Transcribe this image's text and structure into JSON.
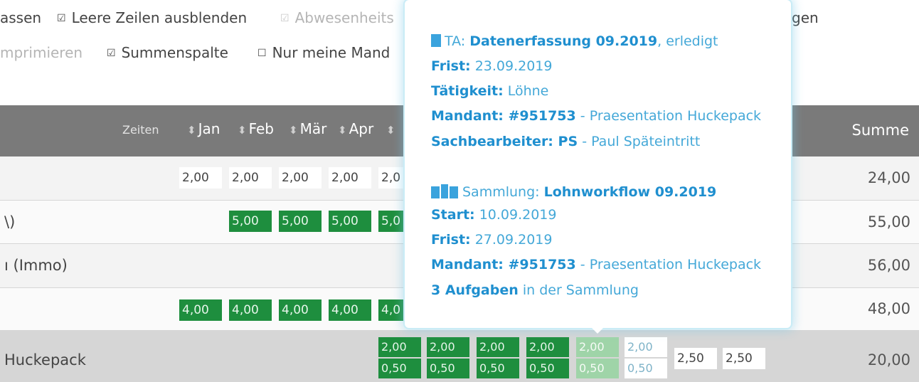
{
  "options": [
    {
      "label": "assen",
      "checked": null,
      "dim": false
    },
    {
      "label": "Leere Zeilen ausblenden",
      "checked": true,
      "dim": false
    },
    {
      "label": "Abwesenheits",
      "checked": true,
      "dim": true
    },
    {
      "label": "gen",
      "checked": null,
      "dim": false
    },
    {
      "label": "mprimieren",
      "checked": null,
      "dim": true
    },
    {
      "label": "Summenspalte",
      "checked": true,
      "dim": false
    },
    {
      "label": "Nur meine Mand",
      "checked": false,
      "dim": false
    }
  ],
  "checkbox_glyphs": {
    "checked": "☑",
    "unchecked": "☐"
  },
  "table": {
    "zeiten_label": "Zeiten",
    "months": [
      "Jan",
      "Feb",
      "Mär",
      "Apr"
    ],
    "sum_header": "Summe",
    "sort_glyph": "⬍"
  },
  "rows": [
    {
      "label": "",
      "sum": "24,00",
      "cells": [
        {
          "v": "2,00",
          "t": "w"
        },
        {
          "v": "2,00",
          "t": "w"
        },
        {
          "v": "2,00",
          "t": "w"
        },
        {
          "v": "2,00",
          "t": "w"
        },
        {
          "v": "2,0",
          "t": "w"
        }
      ]
    },
    {
      "label": "\\)",
      "sum": "55,00",
      "cells": [
        {
          "v": "5,00",
          "t": "g"
        },
        {
          "v": "5,00",
          "t": "g"
        },
        {
          "v": "5,00",
          "t": "g"
        },
        {
          "v": "5,0",
          "t": "g"
        }
      ]
    },
    {
      "label": "ı (Immo)",
      "sum": "56,00",
      "cells": []
    },
    {
      "label": "",
      "sum": "48,00",
      "cells": [
        {
          "v": "4,00",
          "t": "g"
        },
        {
          "v": "4,00",
          "t": "g"
        },
        {
          "v": "4,00",
          "t": "g"
        },
        {
          "v": "4,00",
          "t": "g"
        },
        {
          "v": "4,0",
          "t": "g"
        }
      ]
    },
    {
      "label": "Huckepack",
      "sum": "20,00",
      "top": [
        {
          "v": "2,00",
          "t": "g"
        },
        {
          "v": "2,00",
          "t": "g"
        },
        {
          "v": "2,00",
          "t": "g"
        },
        {
          "v": "2,00",
          "t": "g"
        },
        {
          "v": "2,00",
          "t": "lg"
        },
        {
          "v": "2,00",
          "t": "wb"
        }
      ],
      "bottom": [
        {
          "v": "0,50",
          "t": "g"
        },
        {
          "v": "0,50",
          "t": "g"
        },
        {
          "v": "0,50",
          "t": "g"
        },
        {
          "v": "0,50",
          "t": "g"
        },
        {
          "v": "0,50",
          "t": "lg"
        },
        {
          "v": "0,50",
          "t": "wb"
        }
      ],
      "single": [
        {
          "v": "2,50",
          "t": "w"
        },
        {
          "v": "2,50",
          "t": "w"
        }
      ]
    }
  ],
  "popup": {
    "task": {
      "type": "TA:",
      "title": "Datenerfassung 09.2019",
      "status": ", erledigt",
      "frist_label": "Frist:",
      "frist": "23.09.2019",
      "taetigkeit_label": "Tätigkeit:",
      "taetigkeit": "Löhne",
      "mandant_label": "Mandant: #951753",
      "mandant": "- Praesentation Huckepack",
      "sb_label": "Sachbearbeiter: PS",
      "sb": "- Paul Späteintritt"
    },
    "collection": {
      "type": "Sammlung:",
      "title": "Lohnworkflow 09.2019",
      "start_label": "Start:",
      "start": "10.09.2019",
      "frist_label": "Frist:",
      "frist": "27.09.2019",
      "mandant_label": "Mandant: #951753",
      "mandant": "- Praesentation Huckepack",
      "count_label": "3 Aufgaben",
      "count_suffix": "in der Sammlung"
    },
    "colors": {
      "link": "#1f8fcf",
      "text": "#44a8d8"
    }
  }
}
